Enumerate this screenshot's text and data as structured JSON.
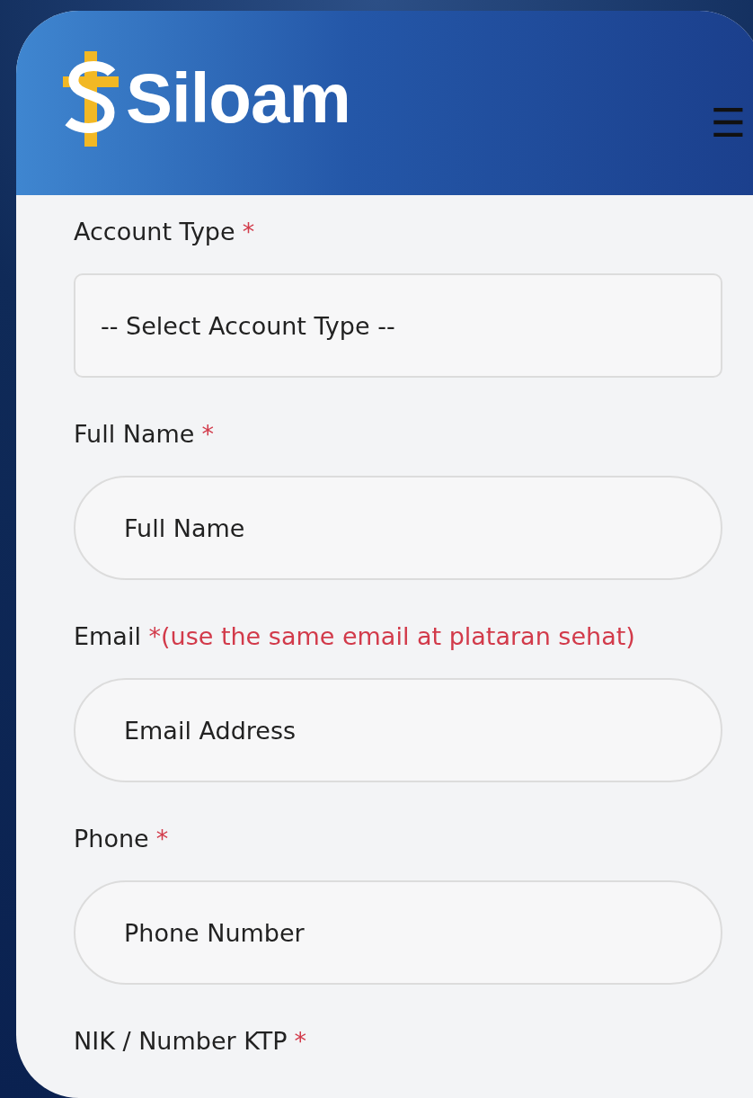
{
  "header": {
    "logo_text": "Siloam",
    "menu_icon": "☰"
  },
  "fields": [
    {
      "kind": "select",
      "label": "Account Type",
      "marker": "*",
      "placeholder": "-- Select Account Type --"
    },
    {
      "kind": "input",
      "label": "Full Name",
      "marker": "*",
      "placeholder": "Full Name"
    },
    {
      "kind": "input",
      "label": "Email",
      "note": "*(use the same email at plataran sehat)",
      "placeholder": "Email Address"
    },
    {
      "kind": "input",
      "label": "Phone",
      "marker": "*",
      "placeholder": "Phone Number"
    },
    {
      "kind": "input",
      "label": "NIK / Number KTP",
      "marker": "*"
    }
  ]
}
